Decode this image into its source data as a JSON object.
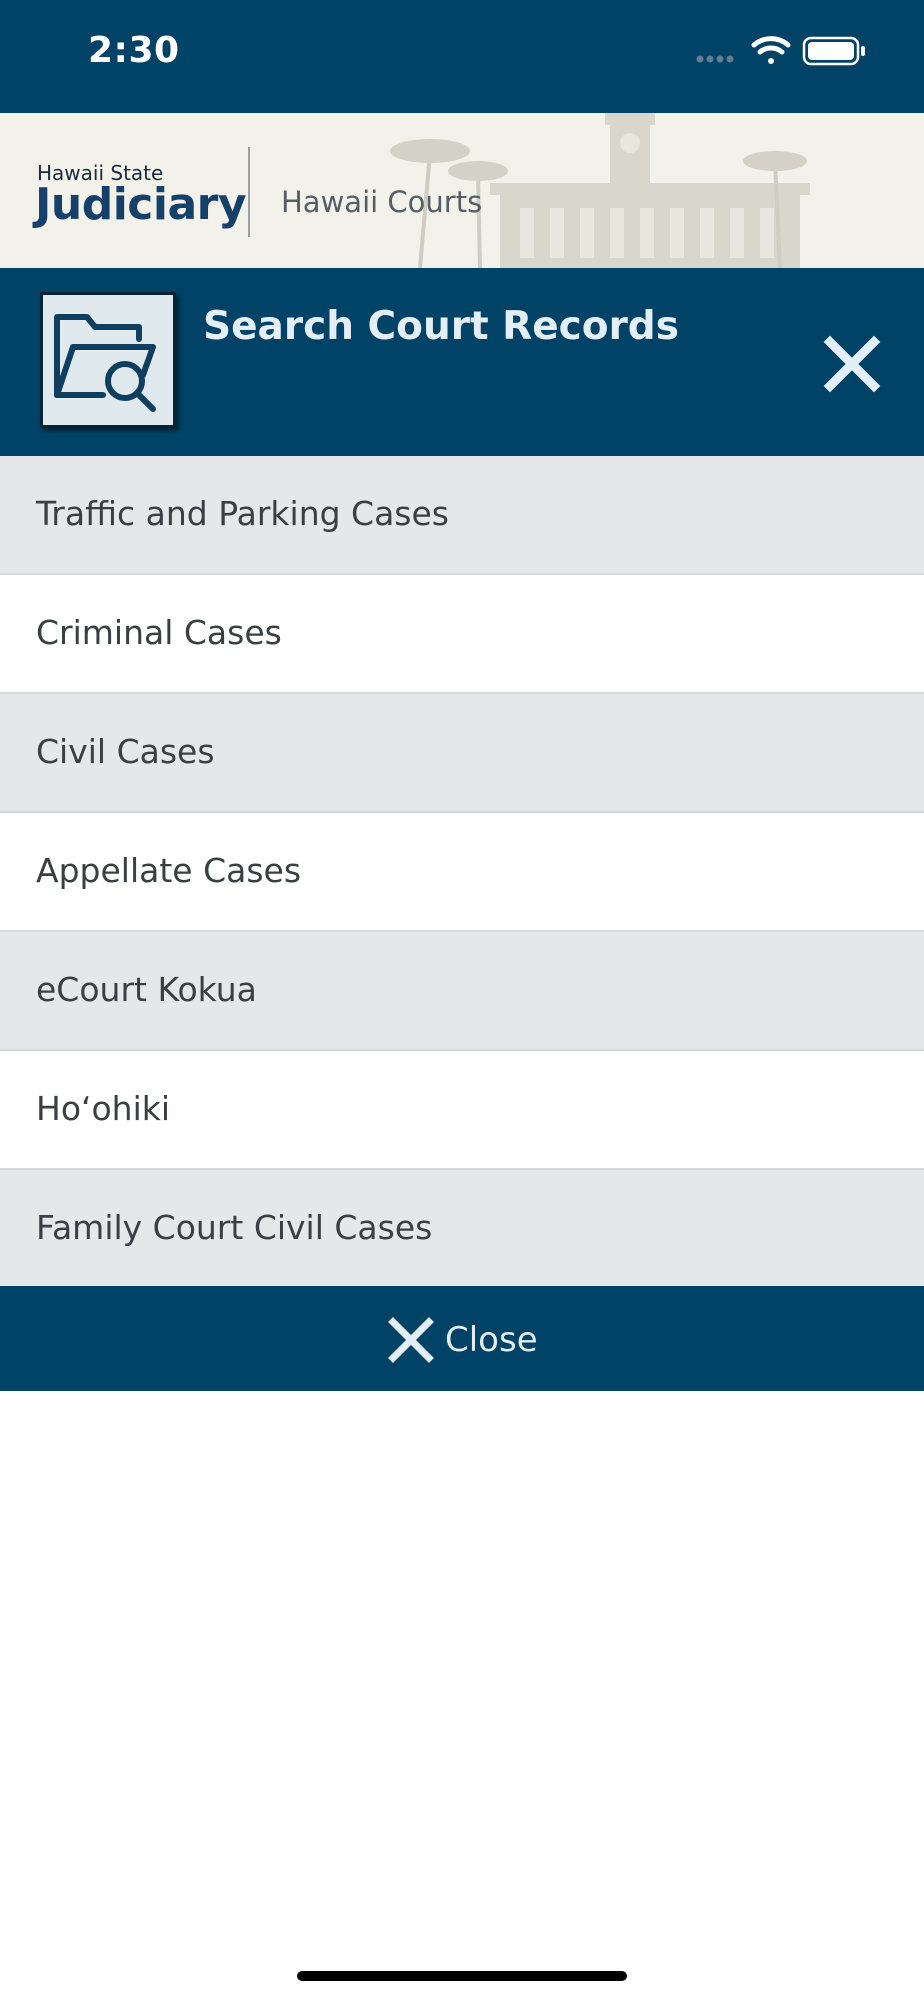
{
  "status_bar": {
    "time": "2:30",
    "icons": [
      "signal-dots-icon",
      "wifi-icon",
      "battery-icon"
    ]
  },
  "banner": {
    "logo_small": "Hawaii State",
    "logo_big": "Judiciary",
    "courts_text": "Hawaii Courts"
  },
  "search_header": {
    "title": "Search Court Records",
    "icon": "folder-search-icon",
    "close_icon": "close-icon"
  },
  "menu": {
    "items": [
      {
        "label": "Traffic and Parking Cases"
      },
      {
        "label": "Criminal Cases"
      },
      {
        "label": "Civil Cases"
      },
      {
        "label": "Appellate Cases"
      },
      {
        "label": "eCourt Kokua"
      },
      {
        "label": "Hoʻohiki"
      },
      {
        "label": "Family Court Civil Cases"
      }
    ]
  },
  "close_bar": {
    "label": "Close",
    "icon": "close-icon"
  },
  "colors": {
    "primary": "#004366",
    "row_shade": "#e6e7e9",
    "banner_bg": "#f3f2ea"
  }
}
